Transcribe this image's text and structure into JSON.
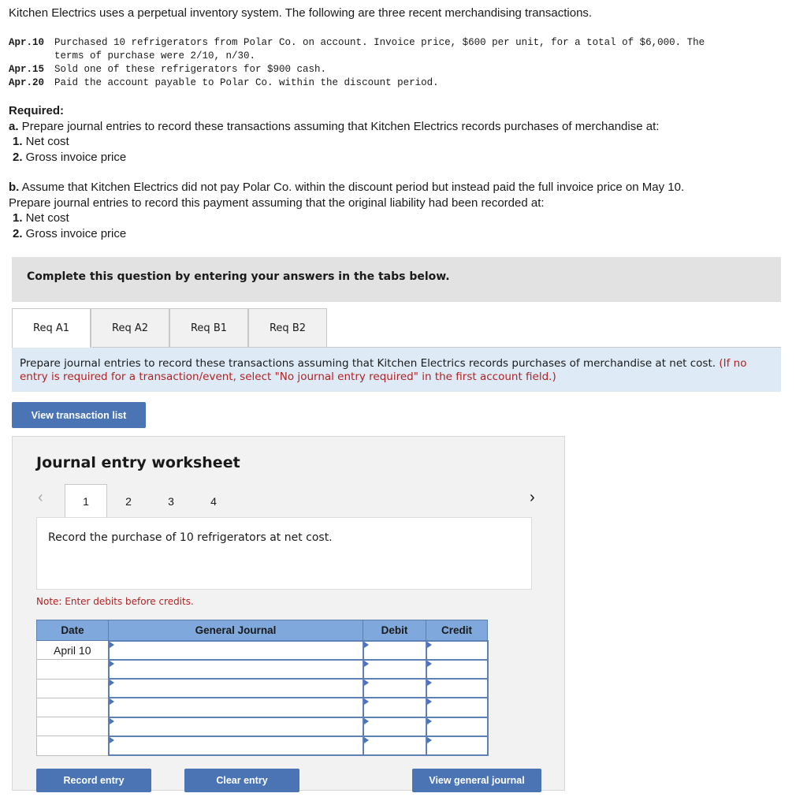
{
  "intro": "Kitchen Electrics uses a perpetual inventory system. The following are three recent merchandising transactions.",
  "transactions": [
    {
      "date": "Apr.10",
      "lines": [
        "Purchased 10 refrigerators from Polar Co. on account. Invoice price, $600 per unit, for a total of $6,000. The",
        "terms of purchase were 2/10, n/30."
      ]
    },
    {
      "date": "Apr.15",
      "lines": [
        "Sold one of these refrigerators for $900 cash."
      ]
    },
    {
      "date": "Apr.20",
      "lines": [
        "Paid the account payable to Polar Co. within the discount period."
      ]
    }
  ],
  "required": {
    "heading": "Required:",
    "a_label": "a.",
    "a_text": " Prepare journal entries to record these transactions assuming that Kitchen Electrics records purchases of merchandise at:",
    "a_items": [
      {
        "num": "1.",
        "text": " Net cost"
      },
      {
        "num": "2.",
        "text": " Gross invoice price"
      }
    ],
    "b_label": "b.",
    "b_text": " Assume that Kitchen Electrics did not pay Polar Co. within the discount period but instead paid the full invoice price on May 10.",
    "b_text2": "Prepare journal entries to record this payment assuming that the original liability had been recorded at:",
    "b_items": [
      {
        "num": "1.",
        "text": " Net cost"
      },
      {
        "num": "2.",
        "text": " Gross invoice price"
      }
    ]
  },
  "banner": "Complete this question by entering your answers in the tabs below.",
  "tabs": [
    "Req A1",
    "Req A2",
    "Req B1",
    "Req B2"
  ],
  "instruction": {
    "text": "Prepare journal entries to record these transactions assuming that Kitchen Electrics records purchases of merchandise at net cost. ",
    "red": "(If no entry is required for a transaction/event, select \"No journal entry required\" in the first account field.)"
  },
  "view_transaction_list": "View transaction list",
  "worksheet": {
    "title": "Journal entry worksheet",
    "prev_icon": "‹",
    "next_icon": "›",
    "pages": [
      "1",
      "2",
      "3",
      "4"
    ],
    "description": "Record the purchase of 10 refrigerators at net cost.",
    "note": "Note: Enter debits before credits.",
    "columns": [
      "Date",
      "General Journal",
      "Debit",
      "Credit"
    ],
    "rows": [
      {
        "date": "April 10",
        "account": "",
        "debit": "",
        "credit": ""
      },
      {
        "date": "",
        "account": "",
        "debit": "",
        "credit": ""
      },
      {
        "date": "",
        "account": "",
        "debit": "",
        "credit": ""
      },
      {
        "date": "",
        "account": "",
        "debit": "",
        "credit": ""
      },
      {
        "date": "",
        "account": "",
        "debit": "",
        "credit": ""
      },
      {
        "date": "",
        "account": "",
        "debit": "",
        "credit": ""
      }
    ],
    "buttons": {
      "record": "Record entry",
      "clear": "Clear entry",
      "view_journal": "View general journal"
    }
  },
  "colors": {
    "button": "#4a74b4",
    "header": "#7fa9dc",
    "note": "#b22222",
    "instruction_bg": "#deebf7"
  }
}
